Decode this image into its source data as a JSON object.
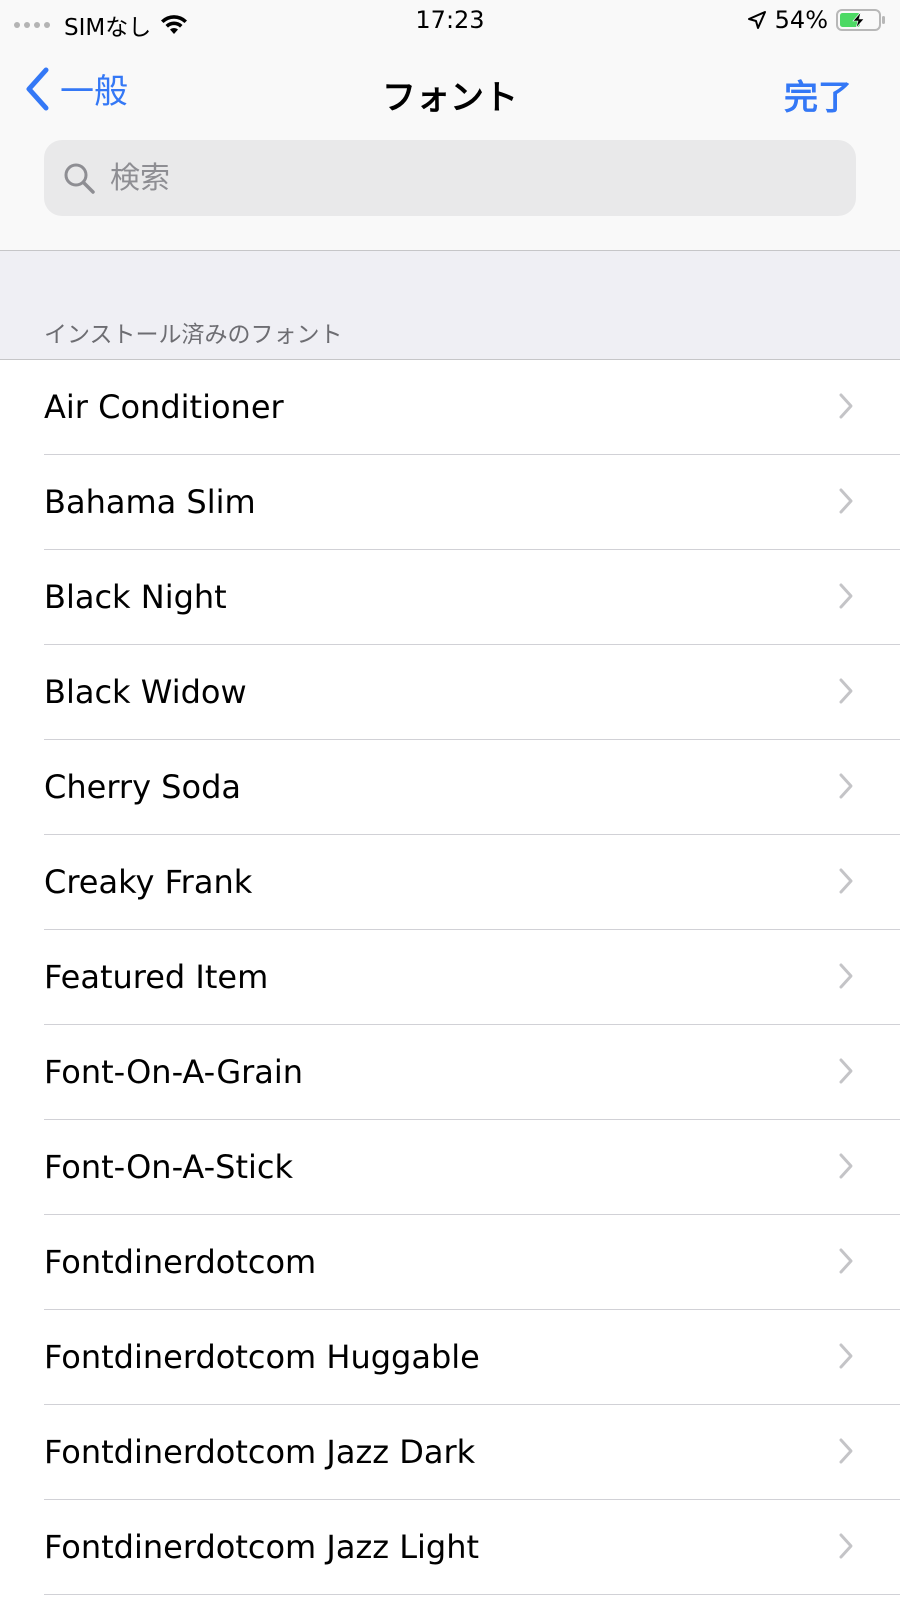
{
  "status_bar": {
    "carrier": "SIMなし",
    "time": "17:23",
    "battery_percent": "54%",
    "battery_level": 0.54,
    "icons": [
      "signal-dots-icon",
      "wifi-icon",
      "location-icon",
      "battery-charging-icon"
    ]
  },
  "nav": {
    "back_label": "一般",
    "title": "フォント",
    "done_label": "完了",
    "accent_color": "#3478f6"
  },
  "search": {
    "placeholder": "検索",
    "value": ""
  },
  "section": {
    "header": "インストール済みのフォント"
  },
  "fonts": [
    {
      "label": "Air Conditioner"
    },
    {
      "label": "Bahama Slim"
    },
    {
      "label": "Black Night"
    },
    {
      "label": "Black Widow"
    },
    {
      "label": "Cherry Soda"
    },
    {
      "label": "Creaky Frank"
    },
    {
      "label": "Featured Item"
    },
    {
      "label": "Font-On-A-Grain"
    },
    {
      "label": "Font-On-A-Stick"
    },
    {
      "label": "Fontdinerdotcom"
    },
    {
      "label": "Fontdinerdotcom Huggable"
    },
    {
      "label": "Fontdinerdotcom Jazz Dark"
    },
    {
      "label": "Fontdinerdotcom Jazz Light"
    }
  ]
}
